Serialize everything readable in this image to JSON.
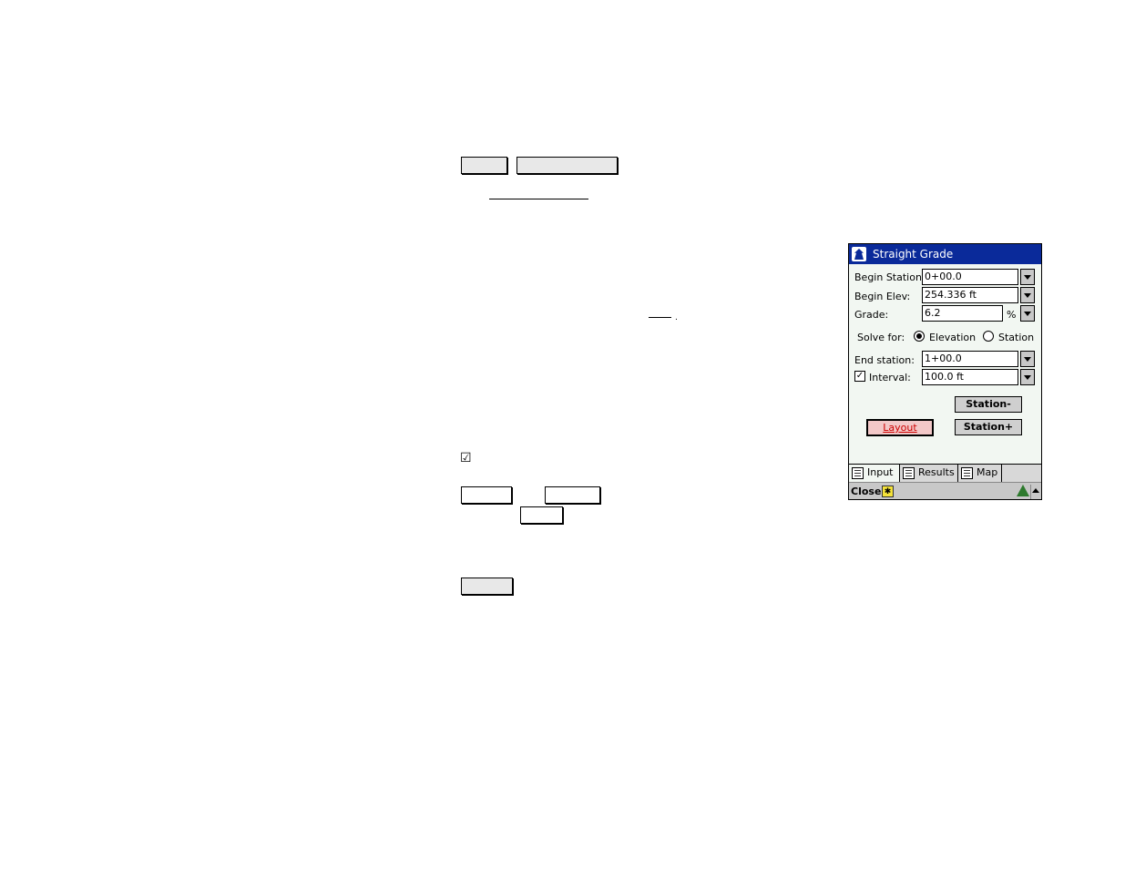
{
  "window": {
    "title": "Straight Grade",
    "app_icon": "surveyor-app-icon"
  },
  "form": {
    "begin_station": {
      "label": "Begin Station:",
      "value": "0+00.0"
    },
    "begin_elev": {
      "label": "Begin Elev:",
      "value": "254.336 ft"
    },
    "grade": {
      "label": "Grade:",
      "value": "6.2",
      "unit": "%"
    },
    "solve_for": {
      "label": "Solve for:",
      "options": [
        "Elevation",
        "Station"
      ],
      "selected": "Elevation"
    },
    "end_station": {
      "label": "End station:",
      "value": "1+00.0"
    },
    "interval": {
      "label": "Interval:",
      "value": "100.0 ft",
      "checked": true
    }
  },
  "buttons": {
    "station_minus": "Station-",
    "station_plus": "Station+",
    "layout": "Layout"
  },
  "tabs": [
    {
      "label": "Input",
      "icon": "input-tab-icon",
      "active": true
    },
    {
      "label": "Results",
      "icon": "results-tab-icon",
      "active": false
    },
    {
      "label": "Map",
      "icon": "map-tab-icon",
      "active": false
    }
  ],
  "menubar": {
    "close": "Close",
    "status_icon": "gps-status-icon",
    "warning_icon": "warning-icon"
  },
  "document": {
    "checkbox_glyph": "☑"
  },
  "colors": {
    "titlebar": "#0a2a9a",
    "screen_bg": "#f2f7f2",
    "layout_text": "#cc0000"
  }
}
